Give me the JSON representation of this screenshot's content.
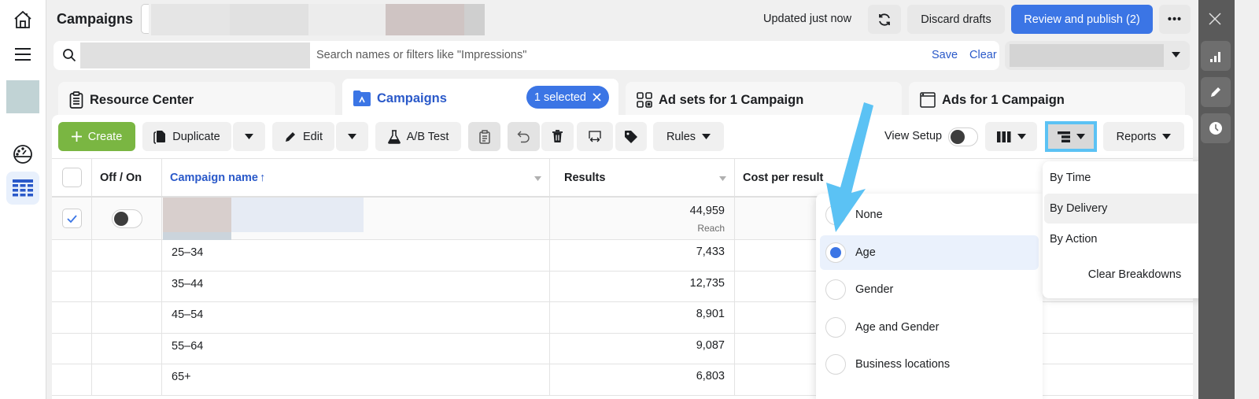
{
  "header": {
    "title": "Campaigns",
    "status": "Updated just now",
    "discard_label": "Discard drafts",
    "publish_label": "Review and publish (2)",
    "more_label": "•••"
  },
  "search": {
    "placeholder": "Search names or filters like \"Impressions\"",
    "save_label": "Save",
    "clear_label": "Clear"
  },
  "tabs": [
    {
      "label": "Resource Center",
      "icon": "clipboard-icon"
    },
    {
      "label": "Campaigns",
      "icon": "folder-icon",
      "active": true,
      "badge": "1 selected"
    },
    {
      "label": "Ad sets for 1 Campaign",
      "icon": "grid-icon"
    },
    {
      "label": "Ads for 1 Campaign",
      "icon": "window-icon"
    }
  ],
  "toolbar": {
    "create_label": "Create",
    "duplicate_label": "Duplicate",
    "edit_label": "Edit",
    "ab_test_label": "A/B Test",
    "rules_label": "Rules",
    "view_setup_label": "View Setup",
    "reports_label": "Reports"
  },
  "table": {
    "columns": [
      "Off / On",
      "Campaign name",
      "Results",
      "Cost per result"
    ],
    "sort_indicator": "↑",
    "campaign_row": {
      "results": "44,959",
      "results_sub": "Reach",
      "checked": true
    },
    "breakdown_rows": [
      {
        "label": "25–34",
        "results": "7,433"
      },
      {
        "label": "35–44",
        "results": "12,735"
      },
      {
        "label": "45–54",
        "results": "8,901"
      },
      {
        "label": "55–64",
        "results": "9,087"
      },
      {
        "label": "65+",
        "results": "6,803"
      }
    ]
  },
  "delivery_menu": {
    "options": [
      "None",
      "Age",
      "Gender",
      "Age and Gender",
      "Business locations"
    ],
    "selected": "Age"
  },
  "breakdown_menu": {
    "items": [
      "By Time",
      "By Delivery",
      "By Action"
    ],
    "highlighted": "By Delivery",
    "clear_label": "Clear Breakdowns"
  },
  "colors": {
    "accent": "#3b75e5",
    "create_green": "#7ab642",
    "annotation": "#5bc2f4"
  }
}
